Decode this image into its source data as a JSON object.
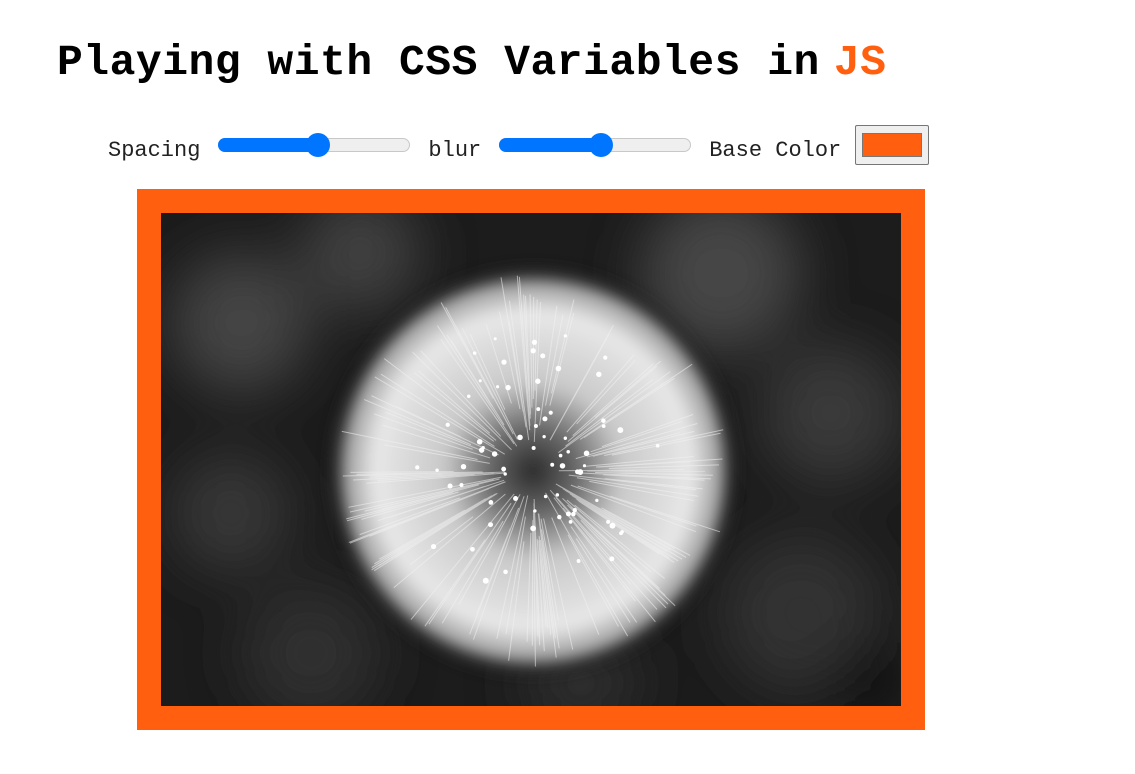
{
  "header": {
    "title": "Playing with CSS Variables in",
    "highlight": "JS"
  },
  "controls": {
    "spacing_label": "Spacing",
    "spacing_value_fraction": 0.52,
    "blur_label": "blur",
    "blur_value_fraction": 0.53,
    "base_color_label": "Base Color",
    "base_color_value": "#ff5f0f"
  },
  "image": {
    "subject": "dandelion-seed-head"
  },
  "colors": {
    "accent": "#ff5f0f",
    "slider_blue": "#0075ff"
  }
}
